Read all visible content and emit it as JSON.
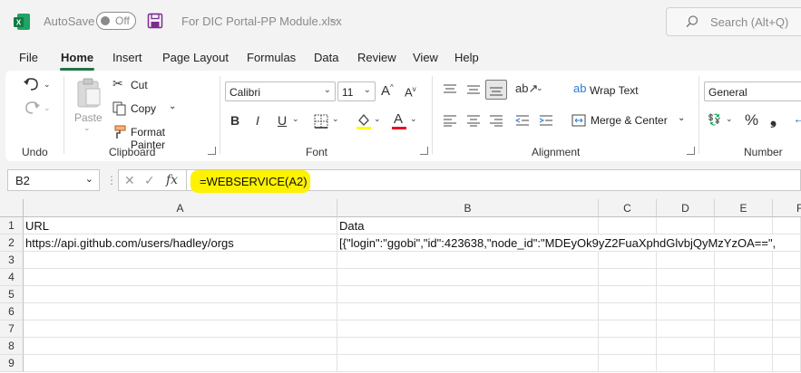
{
  "titlebar": {
    "autosave_label": "AutoSave",
    "autosave_state": "Off",
    "filename": "For DIC Portal-PP Module.xlsx",
    "search_placeholder": "Search (Alt+Q)"
  },
  "tabs": [
    "File",
    "Home",
    "Insert",
    "Page Layout",
    "Formulas",
    "Data",
    "Review",
    "View",
    "Help"
  ],
  "active_tab": "Home",
  "ribbon": {
    "undo_group": "Undo",
    "clipboard": {
      "label": "Clipboard",
      "paste": "Paste",
      "cut": "Cut",
      "copy": "Copy",
      "format_painter": "Format Painter"
    },
    "font": {
      "label": "Font",
      "family": "Calibri",
      "size": "11",
      "bold": "B",
      "italic": "I",
      "underline": "U"
    },
    "alignment": {
      "label": "Alignment",
      "wrap_text": "Wrap Text",
      "merge_center": "Merge & Center"
    },
    "number": {
      "label": "Number",
      "format": "General"
    }
  },
  "formula_bar": {
    "name_box": "B2",
    "fx": "fx",
    "formula": "=WEBSERVICE(A2)"
  },
  "grid": {
    "columns": [
      "A",
      "B",
      "C",
      "D",
      "E",
      "F"
    ],
    "rows": [
      "1",
      "2",
      "3",
      "4",
      "5",
      "6",
      "7",
      "8",
      "9"
    ],
    "cells": {
      "A1": "URL",
      "B1": "Data",
      "A2": "https://api.github.com/users/hadley/orgs",
      "B2": "[{\"login\":\"ggobi\",\"id\":423638,\"node_id\":\"MDEyOk9yZ2FuaXphdGlvbjQyMzYzOA==\","
    }
  },
  "colors": {
    "accent": "#217346",
    "highlight": "#fff200",
    "font_color_bar": "#e81123"
  }
}
